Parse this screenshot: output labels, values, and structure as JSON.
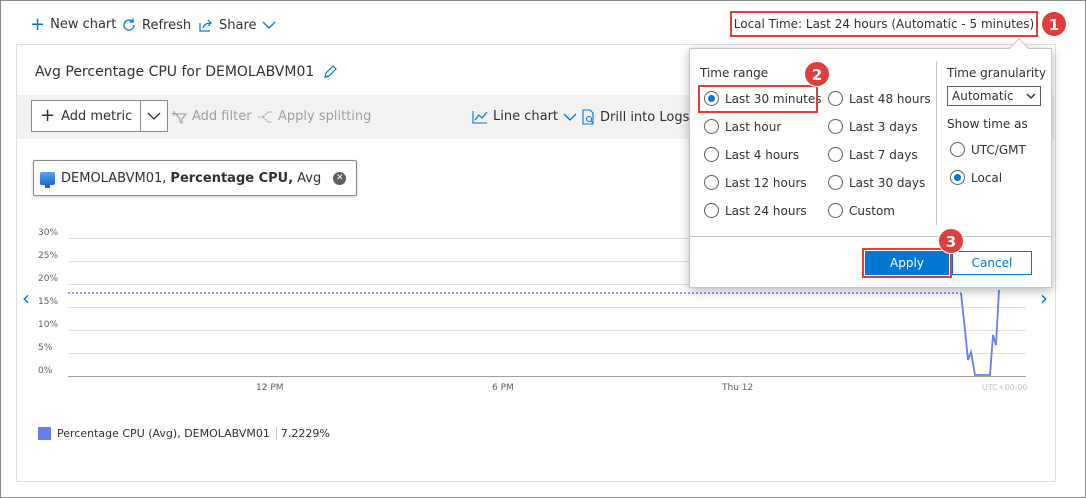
{
  "toolbar": {
    "new_chart": "New chart",
    "refresh": "Refresh",
    "share": "Share",
    "time_range_button": "Local Time: Last 24 hours (Automatic - 5 minutes)"
  },
  "chart": {
    "title": "Avg Percentage CPU for DEMOLABVM01",
    "toolbar": {
      "add_metric": "Add metric",
      "add_filter": "Add filter",
      "apply_splitting": "Apply splitting",
      "line_chart": "Line chart",
      "drill_into_logs": "Drill into Logs"
    },
    "metric_pill": {
      "resource": "DEMOLABVM01,",
      "metric": "Percentage CPU,",
      "aggregation": "Avg"
    },
    "y_ticks": [
      "30%",
      "25%",
      "20%",
      "15%",
      "10%",
      "5%",
      "0%"
    ],
    "x_ticks": [
      "12 PM",
      "6 PM",
      "Thu 12"
    ],
    "timezone_label": "UTC+00:00",
    "legend": {
      "label": "Percentage CPU (Avg), DEMOLABVM01",
      "value": "7.2229%"
    },
    "series_color": "#6b7ee8"
  },
  "popup": {
    "time_range_label": "Time range",
    "options_left": [
      "Last 30 minutes",
      "Last hour",
      "Last 4 hours",
      "Last 12 hours",
      "Last 24 hours"
    ],
    "options_right": [
      "Last 48 hours",
      "Last 3 days",
      "Last 7 days",
      "Last 30 days",
      "Custom"
    ],
    "selected": "Last 30 minutes",
    "granularity_label": "Time granularity",
    "granularity_value": "Automatic",
    "show_time_label": "Show time as",
    "tz_options": [
      "UTC/GMT",
      "Local"
    ],
    "tz_selected": "Local",
    "apply": "Apply",
    "cancel": "Cancel"
  },
  "badges": [
    "1",
    "2",
    "3"
  ],
  "colors": {
    "accent": "#0078d4",
    "highlight": "#e03e3e"
  }
}
